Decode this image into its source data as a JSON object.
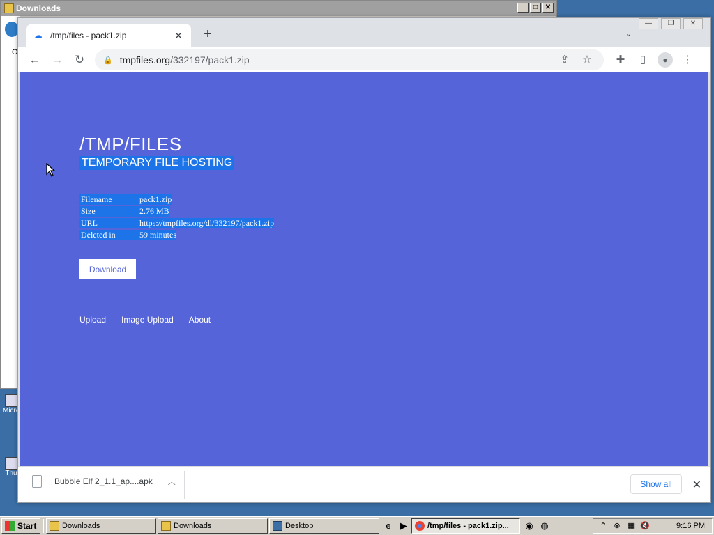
{
  "bg_window": {
    "title": "Downloads",
    "letter": "O"
  },
  "desktop_icons": [
    {
      "label": "Micro"
    },
    {
      "label": "Thu"
    }
  ],
  "tab": {
    "title": "/tmp/files - pack1.zip"
  },
  "address": {
    "host": "tmpfiles.org",
    "path": "/332197/pack1.zip"
  },
  "page": {
    "title": "/TMP/FILES",
    "subtitle": "TEMPORARY FILE HOSTING",
    "info": [
      {
        "key": "Filename",
        "value": "pack1.zip"
      },
      {
        "key": "Size",
        "value": "2.76 MB"
      },
      {
        "key": "URL",
        "value": "https://tmpfiles.org/dl/332197/pack1.zip"
      },
      {
        "key": "Deleted in",
        "value": "59 minutes"
      }
    ],
    "download_label": "Download",
    "footer": {
      "upload": "Upload",
      "image_upload": "Image Upload",
      "about": "About"
    }
  },
  "download_shelf": {
    "item": "Bubble Elf 2_1.1_ap....apk",
    "show_all": "Show all"
  },
  "taskbar": {
    "start": "Start",
    "tasks": [
      "Downloads",
      "Downloads",
      "Desktop",
      "/tmp/files - pack1.zip..."
    ],
    "clock": "9:16 PM"
  }
}
